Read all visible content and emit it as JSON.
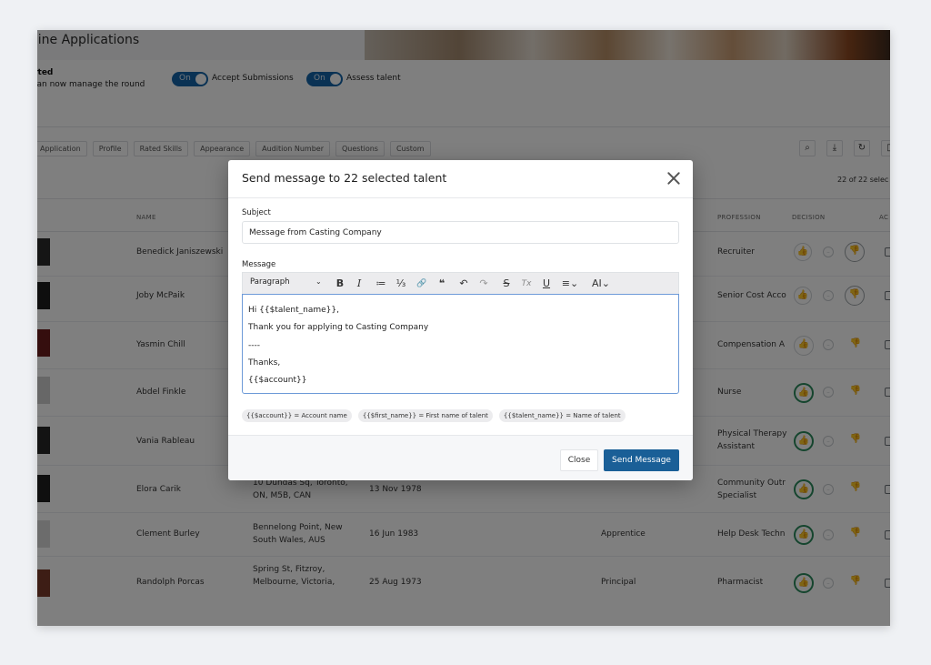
{
  "app": {
    "title": "nline Applications",
    "status_title": "arted",
    "status_subtitle": "u can now manage the round",
    "toggles": [
      {
        "state": "On",
        "label": "Accept Submissions"
      },
      {
        "state": "On",
        "label": "Assess talent"
      }
    ],
    "tabs": [
      "Application",
      "Profile",
      "Rated Skills",
      "Appearance",
      "Audition Number",
      "Questions",
      "Custom"
    ],
    "selected_count": "22 of 22 selec",
    "columns": {
      "name": "NAME",
      "profession": "PROFESSION",
      "decision": "DECISION",
      "actions": "AC"
    },
    "rows": [
      {
        "name": "Benedick Janiszewski",
        "address": "",
        "dob": "",
        "role": "",
        "profession": "Recruiter",
        "decision": "dislike-outline"
      },
      {
        "name": "Joby McPaik",
        "address": "",
        "dob": "",
        "role": "",
        "profession": "Senior Cost Acco",
        "decision": "dislike-outline"
      },
      {
        "name": "Yasmin Chill",
        "address": "",
        "dob": "",
        "role": "",
        "profession": "Compensation A",
        "decision": "like-dim"
      },
      {
        "name": "Abdel Finkle",
        "address": "",
        "dob": "",
        "role": "",
        "profession": "Nurse",
        "decision": "like"
      },
      {
        "name": "Vania Rableau",
        "address": "",
        "dob": "",
        "role": "",
        "profession": "Physical Therapy\nAssistant",
        "decision": "like"
      },
      {
        "name": "Elora Carik",
        "address": "10 Dundas Sq, Toronto,\nON, M5B, CAN",
        "dob": "13 Nov 1978",
        "role": "",
        "profession": "Community Outr\nSpecialist",
        "decision": "like"
      },
      {
        "name": "Clement Burley",
        "address": "Bennelong Point, New\nSouth Wales, AUS",
        "dob": "16 Jun 1983",
        "role": "Apprentice",
        "profession": "Help Desk Techn",
        "decision": "like"
      },
      {
        "name": "Randolph Porcas",
        "address": "Spring St, Fitzroy,\nMelbourne, Victoria,",
        "dob": "25 Aug 1973",
        "role": "Principal",
        "profession": "Pharmacist",
        "decision": "like"
      }
    ]
  },
  "modal": {
    "title": "Send message to 22 selected talent",
    "subject_label": "Subject",
    "subject_value": "Message from Casting Company",
    "message_label": "Message",
    "toolbar": {
      "paragraph": "Paragraph",
      "caret": "⌄",
      "bold": "B",
      "italic": "I",
      "bullet_list": "≔",
      "numbered_list": "⅓",
      "link": "🔗",
      "quote": "❝",
      "undo": "↶",
      "redo": "↷",
      "strikethrough": "S",
      "clear_format": "Tx",
      "underline": "U",
      "align": "≡⌄",
      "font_size": "AI⌄"
    },
    "message_lines": [
      "Hi {{$talent_name}},",
      "Thank you for applying to Casting Company",
      "----",
      "Thanks,",
      "{{$account}}"
    ],
    "placeholders": [
      "{{$account}} = Account name",
      "{{$first_name}} = First name of talent",
      "{{$talent_name}} = Name of talent"
    ],
    "close_label": "Close",
    "send_label": "Send Message"
  },
  "colors": {
    "primary": "#1a5f97",
    "like_green": "#2b8a5c",
    "overlay": "rgba(0,0,0,0.5)"
  }
}
